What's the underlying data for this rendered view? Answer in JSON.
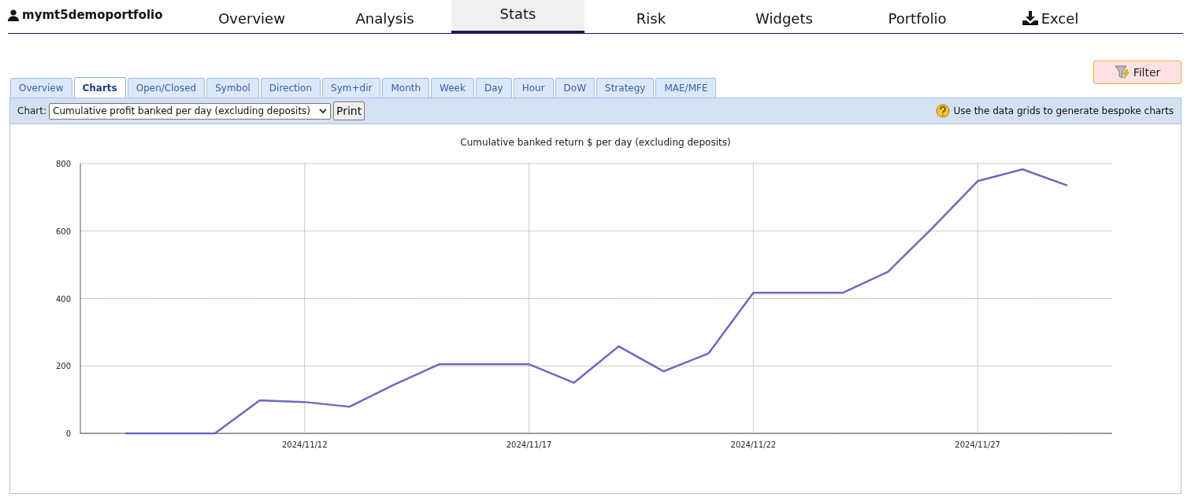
{
  "header": {
    "user": "mymt5demoportfolio",
    "nav": [
      {
        "label": "Overview",
        "selected": false,
        "kind": "link"
      },
      {
        "label": "Analysis",
        "selected": false,
        "kind": "link"
      },
      {
        "label": "Stats",
        "selected": true,
        "kind": "link"
      },
      {
        "label": "Risk",
        "selected": false,
        "kind": "link"
      },
      {
        "label": "Widgets",
        "selected": false,
        "kind": "link"
      },
      {
        "label": "Portfolio",
        "selected": false,
        "kind": "link"
      },
      {
        "label": "Excel",
        "selected": false,
        "kind": "download"
      }
    ]
  },
  "filter_button": "Filter",
  "tabs": [
    {
      "label": "Overview",
      "selected": false
    },
    {
      "label": "Charts",
      "selected": true
    },
    {
      "label": "Open/Closed",
      "selected": false
    },
    {
      "label": "Symbol",
      "selected": false
    },
    {
      "label": "Direction",
      "selected": false
    },
    {
      "label": "Sym+dir",
      "selected": false
    },
    {
      "label": "Month",
      "selected": false
    },
    {
      "label": "Week",
      "selected": false
    },
    {
      "label": "Day",
      "selected": false
    },
    {
      "label": "Hour",
      "selected": false
    },
    {
      "label": "DoW",
      "selected": false
    },
    {
      "label": "Strategy",
      "selected": false
    },
    {
      "label": "MAE/MFE",
      "selected": false
    }
  ],
  "toolbar": {
    "chart_label": "Chart:",
    "chart_select": "Cumulative profit banked per day (excluding deposits)",
    "print_button": "Print",
    "hint": "Use the data grids to generate bespoke charts"
  },
  "chart_data": {
    "type": "line",
    "title": "Cumulative banked return $ per day (excluding deposits)",
    "categories": [
      null,
      null,
      null,
      null,
      "2024/11/12",
      null,
      null,
      null,
      null,
      "2024/11/17",
      null,
      null,
      null,
      null,
      "2024/11/22",
      null,
      null,
      null,
      null,
      "2024/11/27",
      null,
      null
    ],
    "grid": true,
    "series": [
      {
        "color": "#6a6ac0",
        "values": [
          0,
          0,
          0,
          98,
          93,
          79,
          145,
          205,
          205,
          205,
          150,
          258,
          184,
          237,
          417,
          417,
          417,
          479,
          610,
          748,
          783,
          735
        ]
      }
    ],
    "ylim": [
      0,
      800
    ],
    "yticks": [
      0,
      200,
      400,
      600,
      800
    ]
  }
}
